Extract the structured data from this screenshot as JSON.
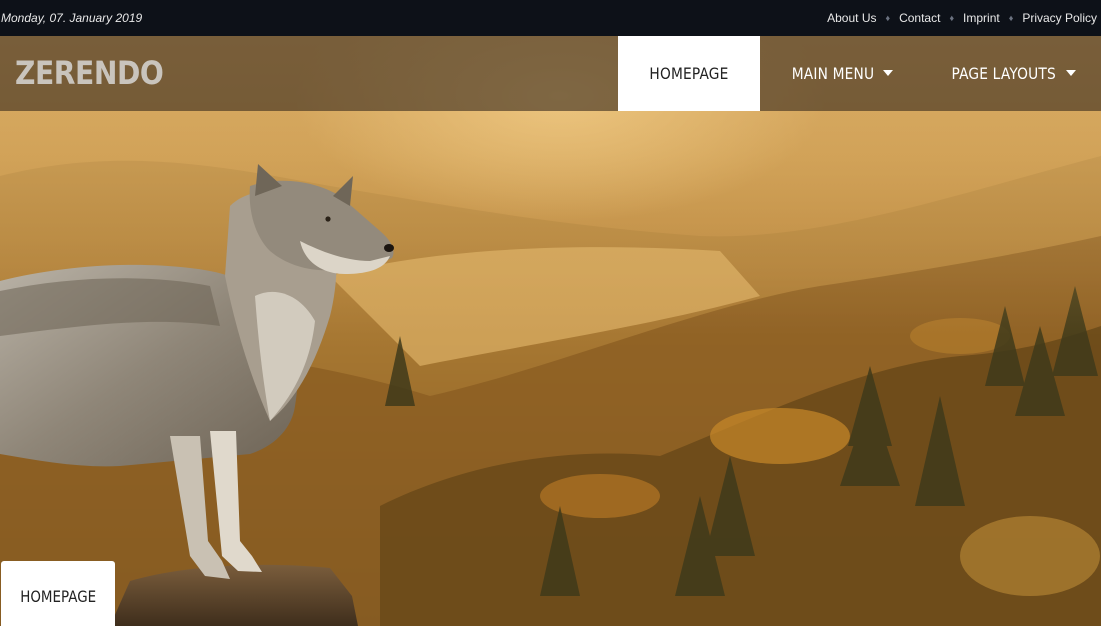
{
  "topbar": {
    "date": "Monday, 07. January 2019",
    "links": [
      "About Us",
      "Contact",
      "Imprint",
      "Privacy Policy"
    ]
  },
  "header": {
    "logo": "ZERENDO",
    "nav": [
      {
        "label": "HOMEPAGE",
        "active": true
      },
      {
        "label": "MAIN MENU",
        "dropdown": true
      },
      {
        "label": "PAGE LAYOUTS",
        "dropdown": true
      }
    ]
  },
  "breadcrumb": {
    "label": "HOMEPAGE"
  },
  "colors": {
    "topbar_bg": "#0d1118",
    "header_overlay": "rgba(60,45,30,0.62)",
    "active_tab": "#ffffff",
    "hero_warm": "#c8964e"
  }
}
